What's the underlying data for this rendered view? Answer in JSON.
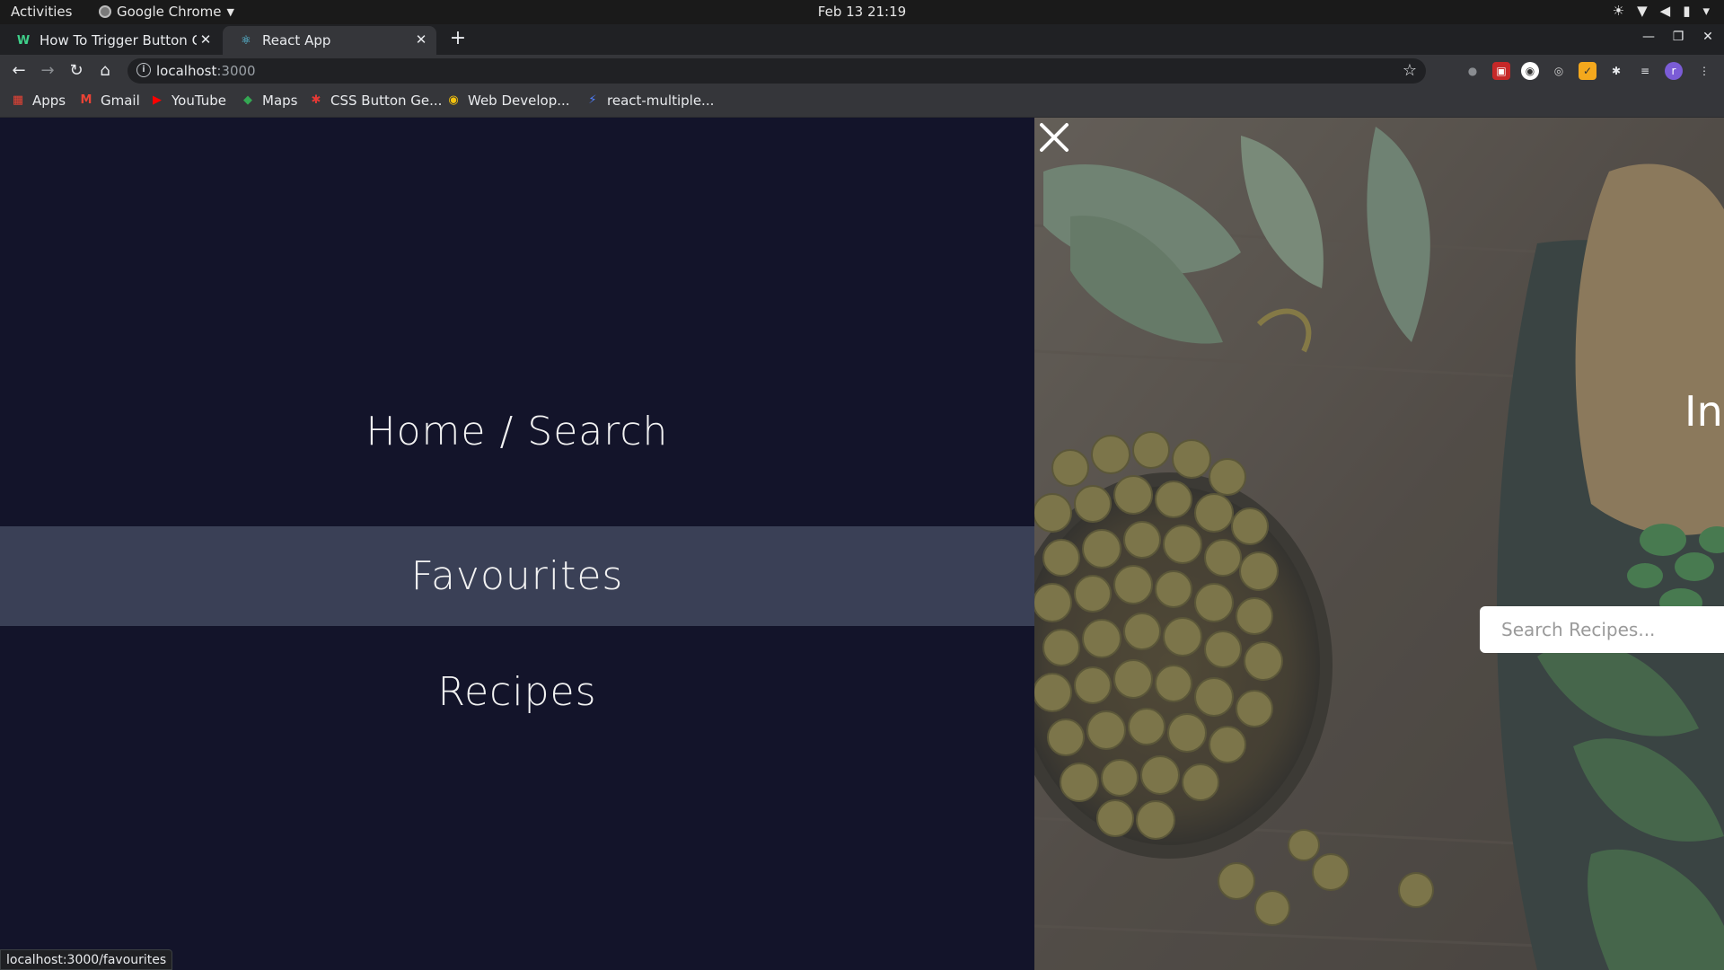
{
  "system_bar": {
    "activities": "Activities",
    "app_name": "Google Chrome",
    "datetime": "Feb 13  21:19",
    "tray_icons": [
      "brightness-icon",
      "wifi-icon",
      "volume-icon",
      "battery-icon",
      "chevron-down-icon"
    ]
  },
  "tabs": [
    {
      "title": "How To Trigger Button Cl",
      "icon": "w-logo-icon",
      "active": false
    },
    {
      "title": "React App",
      "icon": "react-icon",
      "active": true
    }
  ],
  "toolbar": {
    "url_host": "localhost",
    "url_port": ":3000"
  },
  "bookmarks": [
    {
      "label": "Apps",
      "icon": "apps-grid-icon"
    },
    {
      "label": "Gmail",
      "icon": "gmail-icon"
    },
    {
      "label": "YouTube",
      "icon": "youtube-icon"
    },
    {
      "label": "Maps",
      "icon": "maps-icon"
    },
    {
      "label": "CSS Button Ge...",
      "icon": "css-star-icon"
    },
    {
      "label": "Web Develop...",
      "icon": "web-dev-icon"
    },
    {
      "label": "react-multiple...",
      "icon": "lightning-icon"
    }
  ],
  "menu": {
    "items": [
      {
        "label": "Home / Search",
        "active": false
      },
      {
        "label": "Favourites",
        "active": true
      },
      {
        "label": "Recipes",
        "active": false
      }
    ]
  },
  "hero": {
    "title_partial": "In",
    "search_placeholder": "Search Recipes..."
  },
  "status_url": "localhost:3000/favourites",
  "colors": {
    "menu_bg": "#13142a",
    "menu_active_bg": "#3a4056",
    "menu_text": "#f2f2f2"
  }
}
